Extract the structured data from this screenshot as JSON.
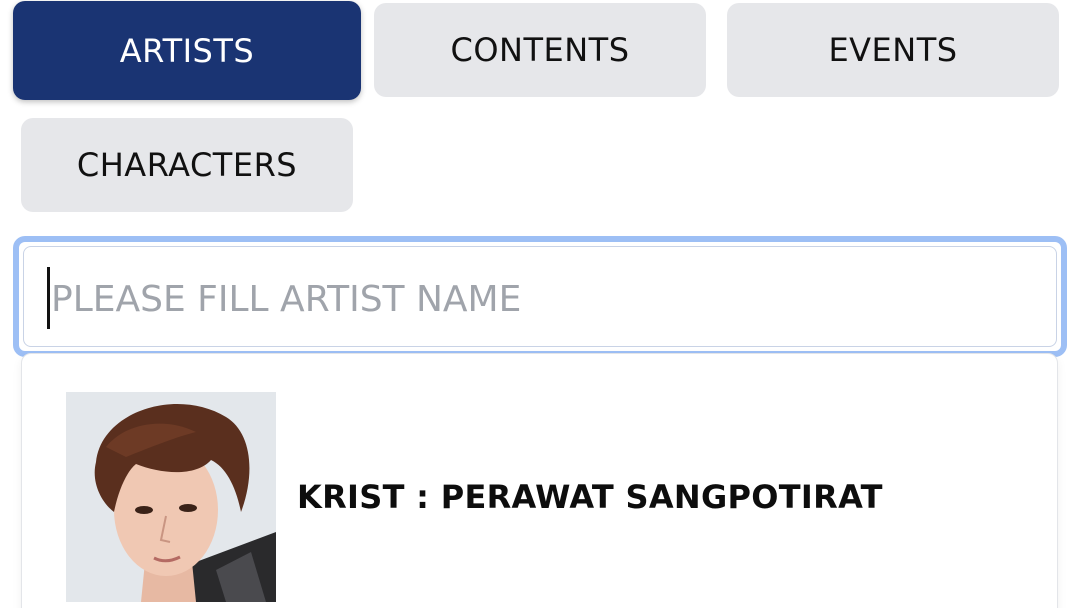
{
  "tabs": [
    {
      "label": "ARTISTS",
      "active": true
    },
    {
      "label": "CONTENTS",
      "active": false
    },
    {
      "label": "EVENTS",
      "active": false
    },
    {
      "label": "CHARACTERS",
      "active": false
    }
  ],
  "search": {
    "value": "",
    "placeholder": "PLEASE FILL ARTIST NAME"
  },
  "results": [
    {
      "name": "KRIST : PERAWAT SANGPOTIRAT",
      "avatar_icon": "artist-portrait"
    }
  ],
  "colors": {
    "tab_active_bg": "#1a3473",
    "tab_inactive_bg": "#e6e7ea",
    "search_focus_ring": "#9dbff5",
    "placeholder": "#a0a4ab"
  }
}
